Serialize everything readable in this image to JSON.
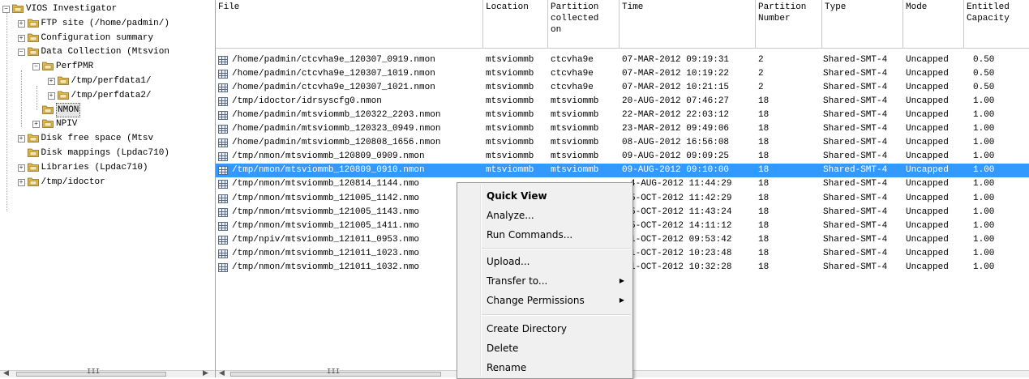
{
  "tree": {
    "items": [
      {
        "label": "VIOS Investigator",
        "expander": "−"
      },
      {
        "label": "FTP site (/home/padmin/)",
        "expander": "+"
      },
      {
        "label": "Configuration summary",
        "expander": "+"
      },
      {
        "label": "Data Collection (Mtsvion",
        "expander": "−"
      },
      {
        "label": "PerfPMR",
        "expander": "−"
      },
      {
        "label": "/tmp/perfdata1/",
        "expander": "+"
      },
      {
        "label": "/tmp/perfdata2/",
        "expander": "+"
      },
      {
        "label": "NMON",
        "expander": ""
      },
      {
        "label": "NPIV",
        "expander": "+"
      },
      {
        "label": "Disk free space (Mtsv",
        "expander": "+"
      },
      {
        "label": "Disk mappings (Lpdac710)",
        "expander": ""
      },
      {
        "label": "Libraries (Lpdac710)",
        "expander": "+"
      },
      {
        "label": "/tmp/idoctor",
        "expander": "+"
      }
    ]
  },
  "table": {
    "headers": {
      "file": "File",
      "location": "Location",
      "partition_collected": "Partition\ncollected\non",
      "time": "Time",
      "partition_number": "Partition\nNumber",
      "type": "Type",
      "mode": "Mode",
      "entitled": "Entitled\nCapacity"
    },
    "rows": [
      {
        "file": "/home/padmin/ctcvha9e_120307_0919.nmon",
        "location": "mtsviommb",
        "partition": "ctcvha9e",
        "time": "07-MAR-2012 09:19:31",
        "number": "2",
        "type": "Shared-SMT-4",
        "mode": "Uncapped",
        "entitled": "0.50"
      },
      {
        "file": "/home/padmin/ctcvha9e_120307_1019.nmon",
        "location": "mtsviommb",
        "partition": "ctcvha9e",
        "time": "07-MAR-2012 10:19:22",
        "number": "2",
        "type": "Shared-SMT-4",
        "mode": "Uncapped",
        "entitled": "0.50"
      },
      {
        "file": "/home/padmin/ctcvha9e_120307_1021.nmon",
        "location": "mtsviommb",
        "partition": "ctcvha9e",
        "time": "07-MAR-2012 10:21:15",
        "number": "2",
        "type": "Shared-SMT-4",
        "mode": "Uncapped",
        "entitled": "0.50"
      },
      {
        "file": "/tmp/idoctor/idrsyscfg0.nmon",
        "location": "mtsviommb",
        "partition": "mtsviommb",
        "time": "20-AUG-2012 07:46:27",
        "number": "18",
        "type": "Shared-SMT-4",
        "mode": "Uncapped",
        "entitled": "1.00"
      },
      {
        "file": "/home/padmin/mtsviommb_120322_2203.nmon",
        "location": "mtsviommb",
        "partition": "mtsviommb",
        "time": "22-MAR-2012 22:03:12",
        "number": "18",
        "type": "Shared-SMT-4",
        "mode": "Uncapped",
        "entitled": "1.00"
      },
      {
        "file": "/home/padmin/mtsviommb_120323_0949.nmon",
        "location": "mtsviommb",
        "partition": "mtsviommb",
        "time": "23-MAR-2012 09:49:06",
        "number": "18",
        "type": "Shared-SMT-4",
        "mode": "Uncapped",
        "entitled": "1.00"
      },
      {
        "file": "/home/padmin/mtsviommb_120808_1656.nmon",
        "location": "mtsviommb",
        "partition": "mtsviommb",
        "time": "08-AUG-2012 16:56:08",
        "number": "18",
        "type": "Shared-SMT-4",
        "mode": "Uncapped",
        "entitled": "1.00"
      },
      {
        "file": "/tmp/nmon/mtsviommb_120809_0909.nmon",
        "location": "mtsviommb",
        "partition": "mtsviommb",
        "time": "09-AUG-2012 09:09:25",
        "number": "18",
        "type": "Shared-SMT-4",
        "mode": "Uncapped",
        "entitled": "1.00"
      },
      {
        "file": "/tmp/nmon/mtsviommb_120809_0910.nmon",
        "location": "mtsviommb",
        "partition": "mtsviommb",
        "time": "09-AUG-2012 09:10:00",
        "number": "18",
        "type": "Shared-SMT-4",
        "mode": "Uncapped",
        "entitled": "1.00"
      },
      {
        "file": "/tmp/nmon/mtsviommb_120814_1144.nmo",
        "location": "",
        "partition": "",
        "time": "4-AUG-2012 11:44:29",
        "number": "18",
        "type": "Shared-SMT-4",
        "mode": "Uncapped",
        "entitled": "1.00"
      },
      {
        "file": "/tmp/nmon/mtsviommb_121005_1142.nmo",
        "location": "",
        "partition": "",
        "time": "5-OCT-2012 11:42:29",
        "number": "18",
        "type": "Shared-SMT-4",
        "mode": "Uncapped",
        "entitled": "1.00"
      },
      {
        "file": "/tmp/nmon/mtsviommb_121005_1143.nmo",
        "location": "",
        "partition": "",
        "time": "5-OCT-2012 11:43:24",
        "number": "18",
        "type": "Shared-SMT-4",
        "mode": "Uncapped",
        "entitled": "1.00"
      },
      {
        "file": "/tmp/nmon/mtsviommb_121005_1411.nmo",
        "location": "",
        "partition": "",
        "time": "5-OCT-2012 14:11:12",
        "number": "18",
        "type": "Shared-SMT-4",
        "mode": "Uncapped",
        "entitled": "1.00"
      },
      {
        "file": "/tmp/npiv/mtsviommb_121011_0953.nmo",
        "location": "",
        "partition": "",
        "time": "1-OCT-2012 09:53:42",
        "number": "18",
        "type": "Shared-SMT-4",
        "mode": "Uncapped",
        "entitled": "1.00"
      },
      {
        "file": "/tmp/nmon/mtsviommb_121011_1023.nmo",
        "location": "",
        "partition": "",
        "time": "1-OCT-2012 10:23:48",
        "number": "18",
        "type": "Shared-SMT-4",
        "mode": "Uncapped",
        "entitled": "1.00"
      },
      {
        "file": "/tmp/nmon/mtsviommb_121011_1032.nmo",
        "location": "",
        "partition": "",
        "time": "1-OCT-2012 10:32:28",
        "number": "18",
        "type": "Shared-SMT-4",
        "mode": "Uncapped",
        "entitled": "1.00"
      }
    ],
    "selected_row": 8
  },
  "context_menu": {
    "quick_view": "Quick View",
    "analyze": "Analyze...",
    "run_commands": "Run Commands...",
    "upload": "Upload...",
    "transfer_to": "Transfer to...",
    "change_permissions": "Change Permissions",
    "create_directory": "Create Directory",
    "delete": "Delete",
    "rename": "Rename"
  },
  "colors": {
    "selection": "#3399ff",
    "folder": "#e0b848",
    "menu_bg": "#f0f0f0"
  },
  "icons": {
    "tree_node": "folder-icon",
    "file": "nmon-file-icon",
    "submenu": "submenu-arrow-icon"
  },
  "scrollbar": {
    "grip": "III"
  }
}
